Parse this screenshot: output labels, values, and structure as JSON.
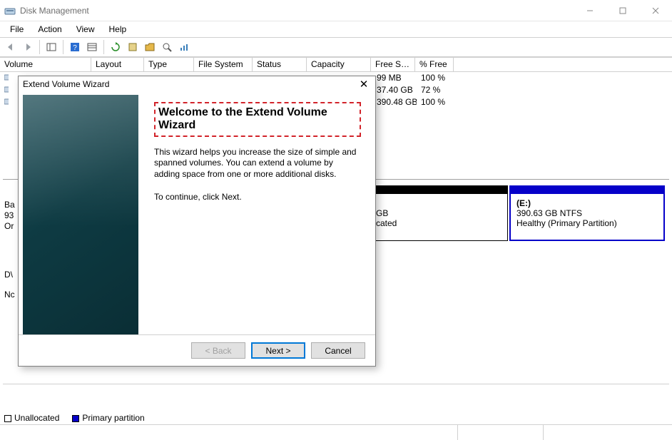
{
  "window": {
    "title": "Disk Management"
  },
  "menubar": [
    "File",
    "Action",
    "View",
    "Help"
  ],
  "grid": {
    "headers": [
      "Volume",
      "Layout",
      "Type",
      "File System",
      "Status",
      "Capacity",
      "Free Spa...",
      "% Free"
    ],
    "widths": [
      128,
      74,
      70,
      82,
      76,
      90,
      62,
      54
    ],
    "rows": [
      {
        "free": "99 MB",
        "pct": "100 %"
      },
      {
        "free": "37.40 GB",
        "pct": "72 %"
      },
      {
        "free": "390.48 GB",
        "pct": "100 %"
      }
    ]
  },
  "disk": {
    "label_prefix": "Ba",
    "size_prefix": "93",
    "status_prefix": "Or",
    "part_mid_suffix1": "GB",
    "part_mid_suffix2": "cated",
    "part_e": {
      "name": "(E:)",
      "size_fs": "390.63 GB NTFS",
      "status": "Healthy (Primary Partition)"
    },
    "dvd_prefix": "D\\",
    "dvd_status_prefix": "Nc"
  },
  "legend": {
    "unallocated": "Unallocated",
    "primary": "Primary partition"
  },
  "wizard": {
    "title": "Extend Volume Wizard",
    "heading": "Welcome to the Extend Volume Wizard",
    "para1": "This wizard helps you increase the size of simple and spanned volumes. You can extend a volume  by adding space from one or more additional disks.",
    "para2": "To continue, click Next.",
    "buttons": {
      "back": "< Back",
      "next": "Next >",
      "cancel": "Cancel"
    }
  }
}
